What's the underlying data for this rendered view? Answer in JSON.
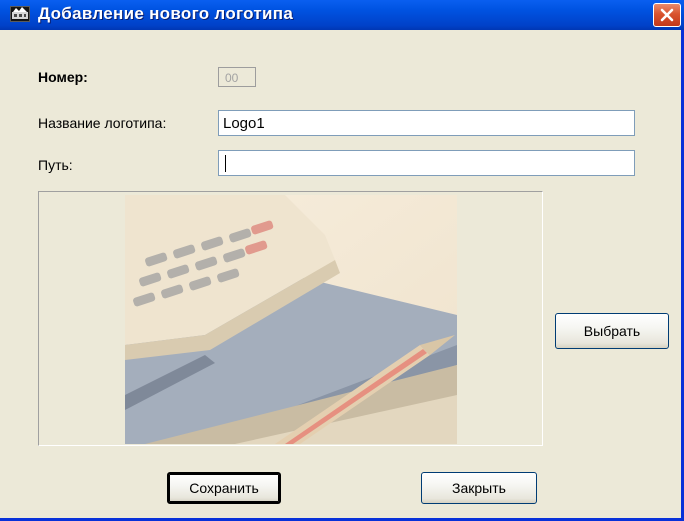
{
  "window": {
    "title": "Добавление нового логотипа",
    "title_icon": "app-logo-icon",
    "close_icon": "close-icon"
  },
  "form": {
    "number_label": "Номер:",
    "number_value": "00",
    "name_label": "Название логотипа:",
    "name_value": "Logo1",
    "path_label": "Путь:",
    "path_value": ""
  },
  "preview": {
    "image_description": "logo-preview-image"
  },
  "buttons": {
    "choose": "Выбрать",
    "save": "Сохранить",
    "close": "Закрыть"
  },
  "colors": {
    "titlebar": "#0054e3",
    "window_bg": "#ece9d8",
    "close_button": "#d9542f"
  }
}
